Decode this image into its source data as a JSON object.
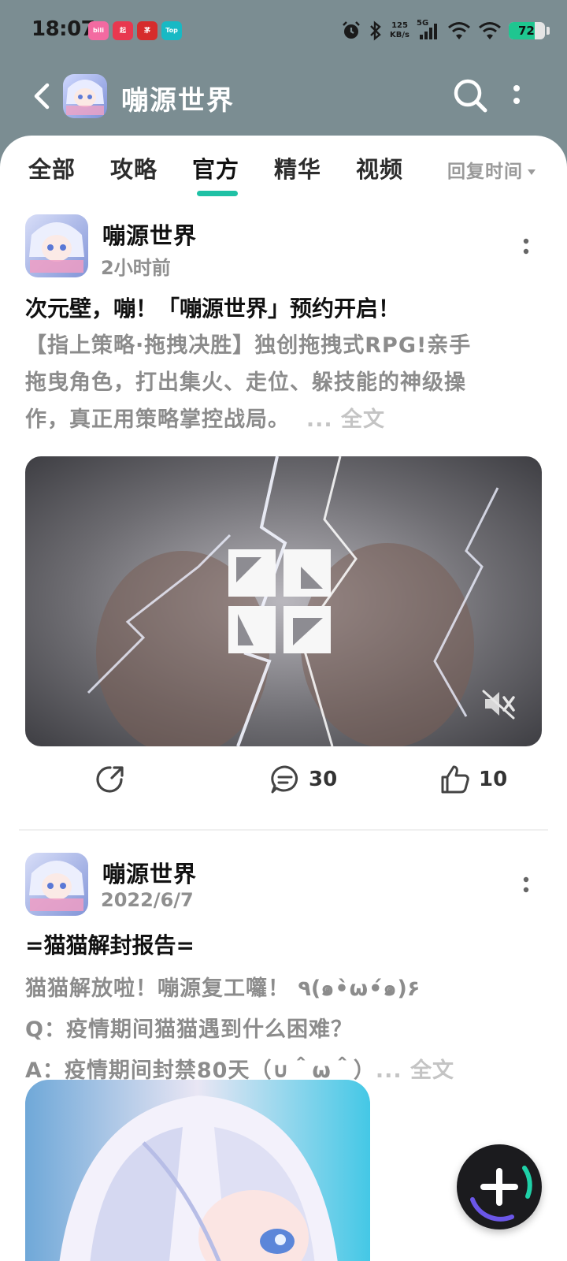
{
  "status_bar": {
    "time": "18:07",
    "notification_icons": [
      "bilibili",
      "起点",
      "茅台",
      "Top"
    ],
    "net_speed_value": "125",
    "net_speed_unit": "KB/s",
    "network": "5G",
    "battery": "72",
    "battery_level": 0.72
  },
  "header": {
    "title": "嘣源世界"
  },
  "tabs": [
    {
      "label": "全部"
    },
    {
      "label": "攻略"
    },
    {
      "label": "官方"
    },
    {
      "label": "精华"
    },
    {
      "label": "视频"
    }
  ],
  "active_tab": "官方",
  "sort": {
    "label": "回复时间"
  },
  "posts": [
    {
      "author": "嘣源世界",
      "time": "2小时前",
      "title": "次元壁，嘣！「嘣源世界」预约开启！",
      "body_lines": [
        "【指上策略·拖拽决胜】独创拖拽式RPG!亲手",
        "拖曳角色，打出集火、走位、躲技能的神级操",
        "作，真正用策略掌控战局。"
      ],
      "ellipsis": "...",
      "full_text_label": "全文",
      "media_logo": "BONG",
      "comments": "30",
      "likes": "10"
    },
    {
      "author": "嘣源世界",
      "time": "2022/6/7",
      "title": "=猫猫解封报告=",
      "body_lines": [
        "猫猫解放啦！嘣源复工囖！ ٩(๑•̀ω•́๑)۶",
        "Q：疫情期间猫猫遇到什么困难？",
        "A：疫情期间封禁80天（∪＾ω＾）"
      ],
      "ellipsis": "...",
      "full_text_label": "全文"
    }
  ],
  "colors": {
    "header_bg": "#7b8d92",
    "accent": "#1fc1a5",
    "battery": "#1fc690"
  }
}
